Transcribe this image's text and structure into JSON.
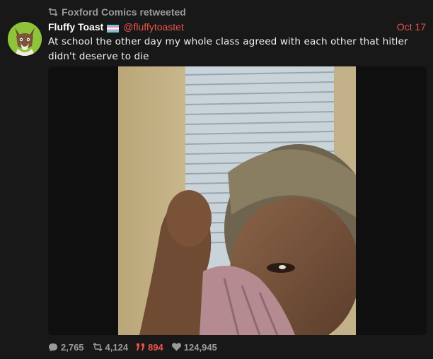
{
  "retweet": {
    "icon": "retweet-icon",
    "label": "Foxford Comics retweeted"
  },
  "tweet": {
    "author_name": "Fluffy Toast",
    "author_flag": "trans-flag-icon",
    "handle": "@fluffytoastet",
    "date": "Oct 17",
    "text": "At school the other day my whole class agreed with each other that hitler didn't deserve to die"
  },
  "stats": {
    "replies": "2,765",
    "retweets": "4,124",
    "quotes": "894",
    "likes": "124,945"
  },
  "colors": {
    "background": "#181818",
    "accent": "#e8534c",
    "muted": "#9a9a9a",
    "avatar_bg": "#8fc43a"
  }
}
